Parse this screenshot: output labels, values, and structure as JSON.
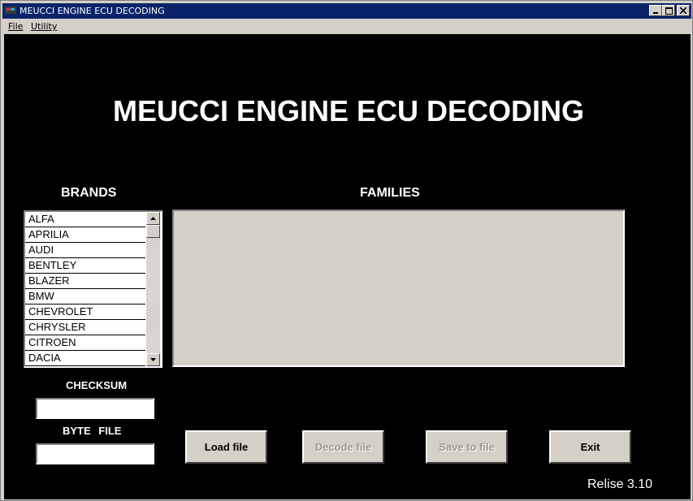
{
  "window": {
    "title": "MEUCCI ENGINE ECU DECODING"
  },
  "menu": {
    "file": "File",
    "utility": "Utility"
  },
  "main": {
    "title": "MEUCCI ENGINE ECU DECODING",
    "brands_label": "BRANDS",
    "families_label": "FAMILIES",
    "checksum_label": "CHECKSUM",
    "bytefile_label": "BYTE FILE",
    "checksum_value": "",
    "bytefile_value": "",
    "version": "Relise 3.10"
  },
  "brands": [
    "ALFA",
    "APRILIA",
    "AUDI",
    "BENTLEY",
    "BLAZER",
    "BMW",
    "CHEVROLET",
    "CHRYSLER",
    "CITROEN",
    "DACIA"
  ],
  "buttons": {
    "load": "Load file",
    "decode": "Decode file",
    "save": "Save to file",
    "exit": "Exit"
  },
  "colors": {
    "titlebar": "#0a246a",
    "client_background": "#000000",
    "face": "#d4d0c8"
  },
  "icons": {
    "app": "app-icon",
    "minimize": "minimize-icon",
    "maximize": "maximize-icon",
    "close": "close-icon",
    "scroll_up": "arrow-up-icon",
    "scroll_down": "arrow-down-icon"
  }
}
